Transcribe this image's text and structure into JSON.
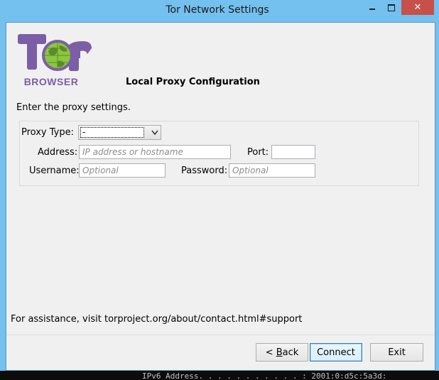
{
  "window": {
    "title": "Tor Network Settings",
    "minimize_glyph": "",
    "close_glyph": "✕"
  },
  "logo": {
    "word": "BROWSER",
    "brand_color": "#7b5ea5",
    "globe_color": "#8cc63f"
  },
  "page": {
    "heading": "Local Proxy Configuration",
    "instruction": "Enter the proxy settings.",
    "assistance": "For assistance, visit torproject.org/about/contact.html#support"
  },
  "proxy_form": {
    "type_label": "Proxy Type:",
    "type_value": "-",
    "address_label": "Address:",
    "address_placeholder": "IP address or hostname",
    "port_label": "Port:",
    "port_value": "",
    "username_label": "Username:",
    "username_placeholder": "Optional",
    "password_label": "Password:",
    "password_placeholder": "Optional"
  },
  "buttons": {
    "back_prefix": "< ",
    "back_mnemonic": "B",
    "back_rest": "ack",
    "connect": "Connect",
    "exit": "Exit"
  },
  "console": {
    "text": "IPv6 Address. . . . . . . . . . . : 2001:0:d5c:5a3d:"
  }
}
